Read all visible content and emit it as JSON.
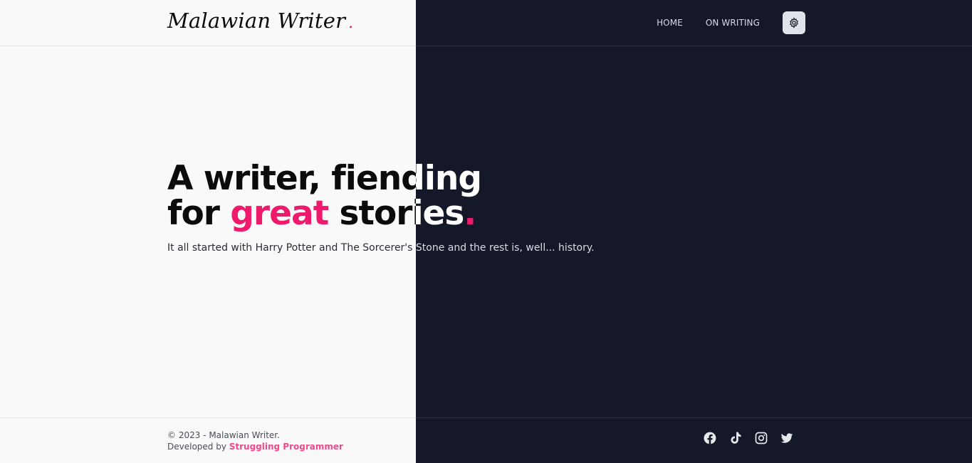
{
  "brand": {
    "name": "Malawian Writer",
    "dot": "."
  },
  "nav": {
    "items": [
      {
        "label": "HOME"
      },
      {
        "label": "ON WRITING"
      }
    ],
    "theme_toggle": {
      "icon": "gear-icon"
    }
  },
  "hero": {
    "line1": "A writer, fiending",
    "line2_pre": "for ",
    "line2_accent": "great",
    "line2_post": " stories",
    "dot": ".",
    "subtitle": "It all started with Harry Potter and The Sorcerer's Stone and the rest is, well... history."
  },
  "footer": {
    "copyright": "© 2023 - Malawian Writer.",
    "developed_by": "Developed by ",
    "developer": "Struggling Programmer",
    "socials": [
      "facebook-icon",
      "tiktok-icon",
      "instagram-icon",
      "twitter-icon"
    ]
  },
  "colors": {
    "accent": "#ef1a6b",
    "dark_bg": "#141828",
    "light_bg": "#f9f9f9"
  }
}
